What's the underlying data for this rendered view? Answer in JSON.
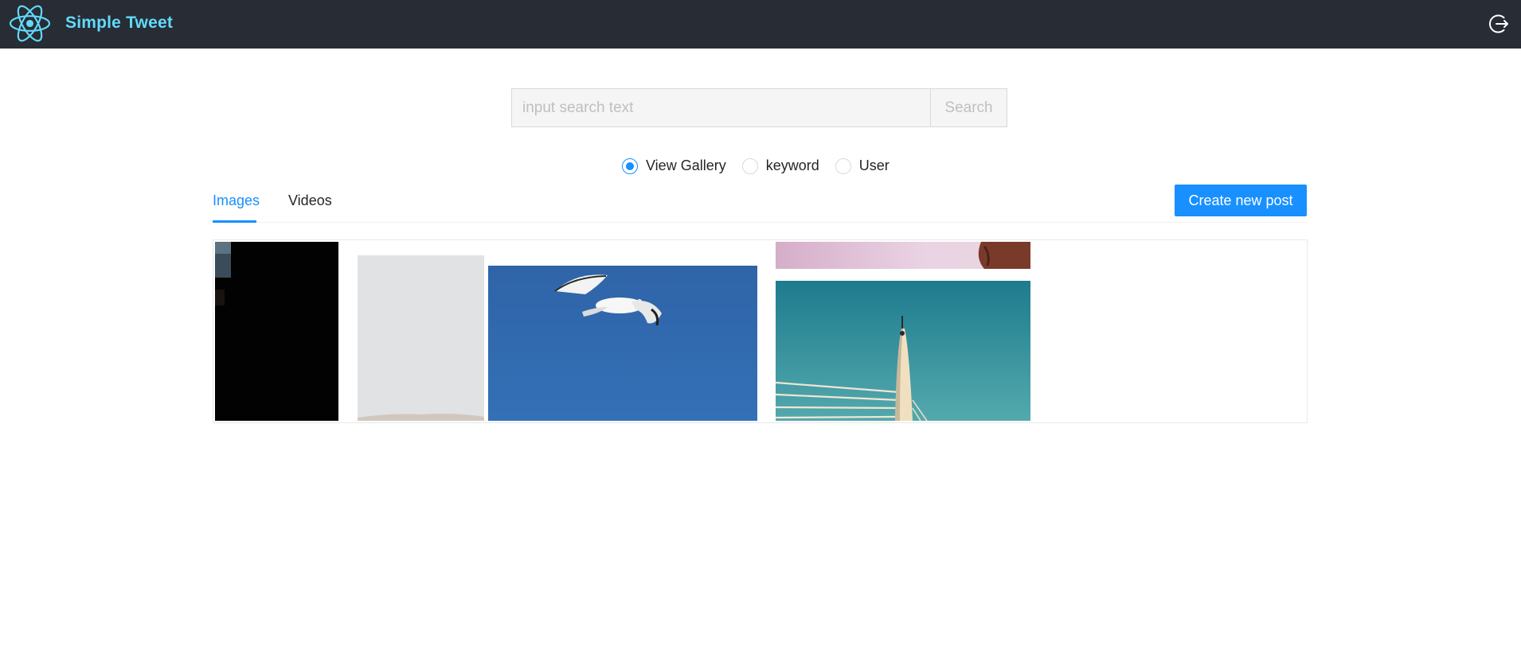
{
  "header": {
    "app_title": "Simple Tweet",
    "logo_icon": "react-atom-icon",
    "logout_icon": "logout-icon",
    "brand_color": "#61dafb",
    "background": "#282c34"
  },
  "search": {
    "placeholder": "input search text",
    "value": "",
    "button_label": "Search"
  },
  "search_options": [
    {
      "label": "View Gallery",
      "checked": true
    },
    {
      "label": "keyword",
      "checked": false
    },
    {
      "label": "User",
      "checked": false
    }
  ],
  "tabs": [
    {
      "label": "Images",
      "active": true
    },
    {
      "label": "Videos",
      "active": false
    }
  ],
  "actions": {
    "create_label": "Create new post",
    "accent": "#1890ff"
  },
  "gallery": {
    "images": [
      {
        "subject": "dark photo"
      },
      {
        "subject": "pale grey sky"
      },
      {
        "subject": "seagull in blue sky"
      },
      {
        "subject": "pink close-up"
      },
      {
        "subject": "bridge pylon against teal sky"
      }
    ]
  }
}
